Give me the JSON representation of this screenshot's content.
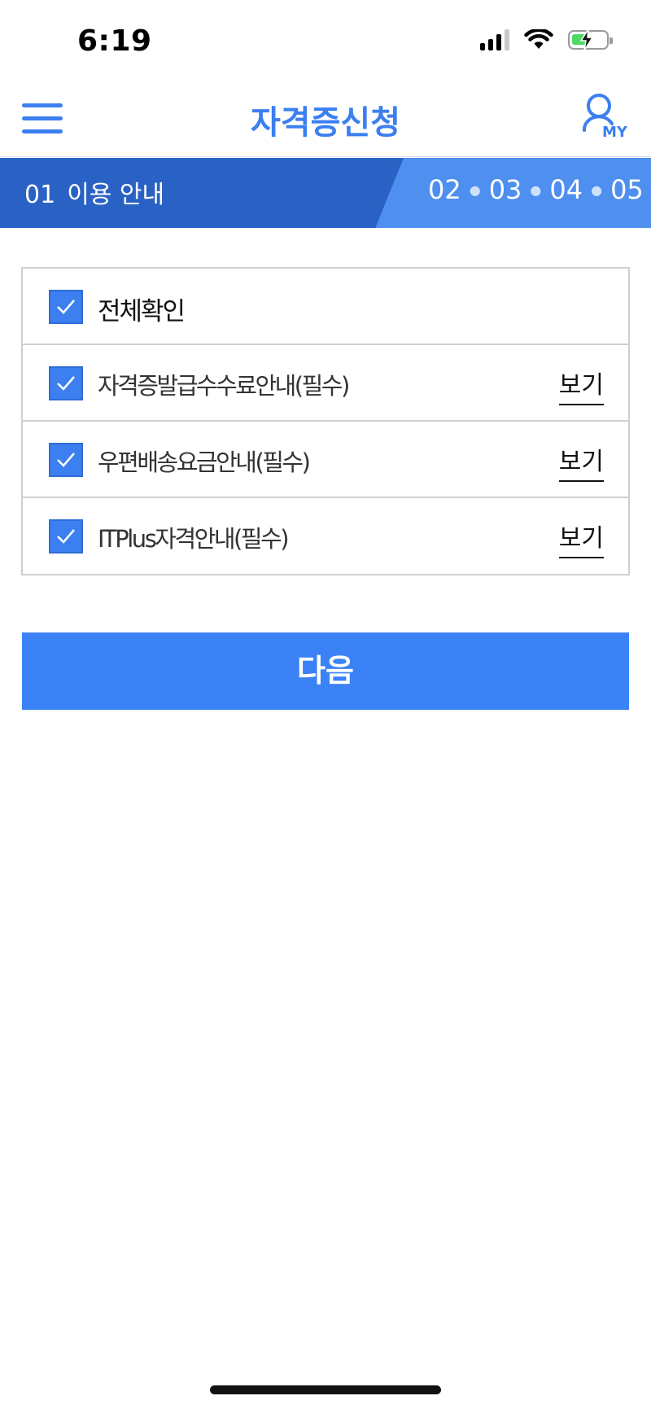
{
  "status_bar": {
    "time": "6:19",
    "icons": [
      "signal-icon",
      "wifi-icon",
      "battery-charging-icon"
    ]
  },
  "header": {
    "title": "자격증신청",
    "menu_icon": "hamburger-menu-icon",
    "my_icon": "user-my-icon",
    "my_label": "MY"
  },
  "steps": {
    "current_number": "01",
    "current_label": "이용 안내",
    "rest": [
      "02",
      "03",
      "04",
      "05"
    ]
  },
  "agreements": {
    "all_label": "전체확인",
    "view_label": "보기",
    "items": [
      {
        "label": "자격증발급수수료안내(필수)",
        "checked": true
      },
      {
        "label": "우편배송요금안내(필수)",
        "checked": true
      },
      {
        "label": "ITPlus자격안내(필수)",
        "checked": true
      }
    ],
    "all_checked": true
  },
  "next_button": {
    "label": "다음"
  },
  "colors": {
    "accent": "#3b7ff0",
    "step_bar_dark": "#2962c4",
    "step_bar_light": "#4e8ff0",
    "button": "#3b82f6",
    "border": "#cfcfcf"
  }
}
